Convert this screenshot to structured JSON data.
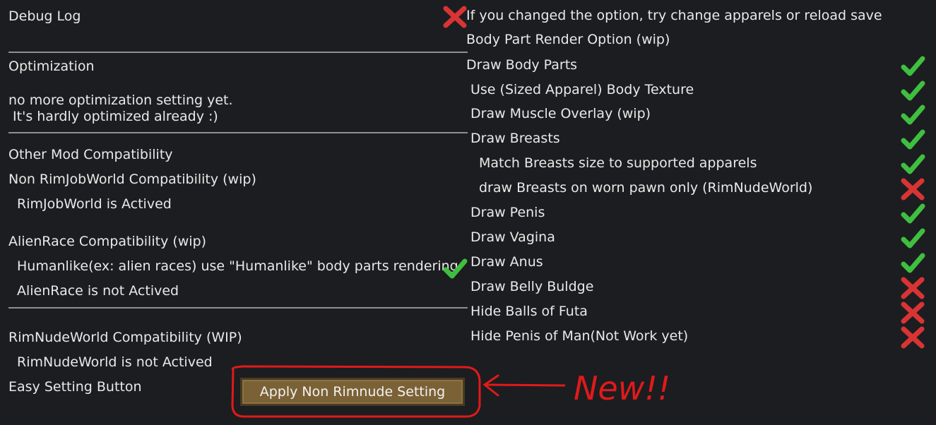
{
  "left": {
    "debug_log": "Debug Log",
    "optimization": "Optimization",
    "opt_msg1": "no more optimization setting yet.",
    "opt_msg2": " It's hardly optimized already :)",
    "other_mod": "Other Mod Compatibility",
    "non_rjw": "Non RimJobWorld Compatibility (wip)",
    "rjw_actived": "RimJobWorld is Actived",
    "alienrace": "AlienRace Compatibility (wip)",
    "humanlike": "Humanlike(ex: alien races) use \"Humanlike\" body parts rendering",
    "alien_not": "AlienRace is not Actived",
    "rimnude": "RimNudeWorld Compatibility (WIP)",
    "rimnude_not": "RimNudeWorld is not Actived",
    "easy_setting": "Easy Setting Button",
    "button_label": "Apply Non Rimnude Setting"
  },
  "right": {
    "notice": "If you changed the option, try change apparels or reload save",
    "render_option": "Body Part Render Option (wip)",
    "options": [
      {
        "label": "Draw Body Parts",
        "checked": true
      },
      {
        "label": "Use (Sized Apparel) Body Texture",
        "checked": true
      },
      {
        "label": "Draw Muscle Overlay (wip)",
        "checked": true
      },
      {
        "label": "Draw Breasts",
        "checked": true
      },
      {
        "label": "Match Breasts size to supported apparels",
        "checked": true
      },
      {
        "label": "draw Breasts on worn pawn only (RimNudeWorld)",
        "checked": false
      },
      {
        "label": "Draw Penis",
        "checked": true
      },
      {
        "label": "Draw Vagina",
        "checked": true
      },
      {
        "label": "Draw Anus",
        "checked": true
      },
      {
        "label": "Draw Belly Buldge",
        "checked": false
      },
      {
        "label": "Hide Balls of Futa",
        "checked": false
      },
      {
        "label": "Hide Penis of Man(Not Work yet)",
        "checked": false
      }
    ]
  },
  "debug_checked": false,
  "humanlike_checked": true,
  "annotation": "New!!",
  "colors": {
    "check": "#3fbf3f",
    "cross": "#d83434",
    "annotation": "#e01a1a"
  }
}
